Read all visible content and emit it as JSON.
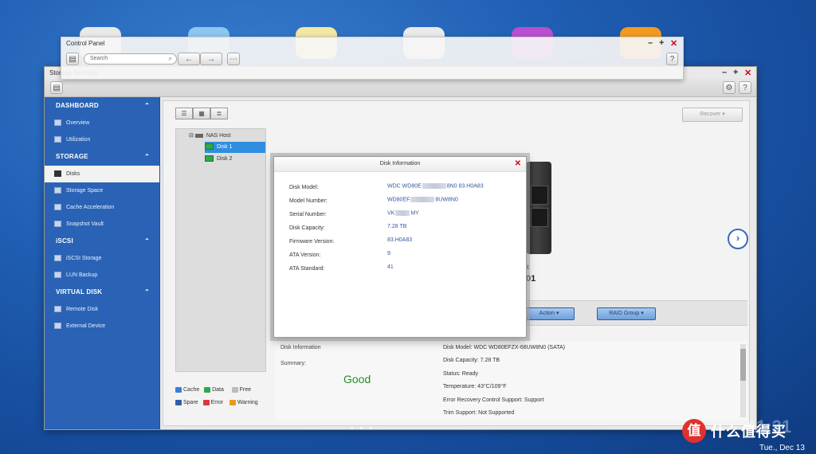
{
  "control_panel": {
    "title": "Control Panel",
    "search_placeholder": "Search"
  },
  "storage_manager": {
    "title": "Storage Manager",
    "sidebar": {
      "sections": [
        {
          "label": "DASHBOARD",
          "items": [
            "Overview",
            "Utilization"
          ]
        },
        {
          "label": "STORAGE",
          "items": [
            "Disks",
            "Storage Space",
            "Cache Acceleration",
            "Snapshot Vault"
          ]
        },
        {
          "label": "iSCSI",
          "items": [
            "iSCSI Storage",
            "LUN Backup"
          ]
        },
        {
          "label": "VIRTUAL DISK",
          "items": [
            "Remote Disk",
            "External Device"
          ]
        }
      ],
      "active_item": "Disks"
    },
    "recover_label": "Recover",
    "tree": {
      "host": "NAS Host",
      "disks": [
        "Disk 1",
        "Disk 2"
      ],
      "selected": "Disk 1"
    },
    "nas_label_partial_1": "t",
    "nas_label_partial_2": "01",
    "actions": {
      "action_label": "Action",
      "raid_label": "RAID Group"
    },
    "legend": [
      {
        "label": "Cache",
        "color": "#3a7fd6"
      },
      {
        "label": "Data",
        "color": "#2ea84a"
      },
      {
        "label": "Free",
        "color": "#bbbbbb"
      },
      {
        "label": "Spare",
        "color": "#2f5fa8"
      },
      {
        "label": "Error",
        "color": "#d63a3a"
      },
      {
        "label": "Warning",
        "color": "#e89a1c"
      }
    ],
    "info_pane": {
      "heading": "Disk Information",
      "summary_label": "Summary:",
      "summary_value": "Good",
      "details": [
        "Disk Model: WDC WD80EFZX-68UW8N0 (SATA)",
        "Disk Capacity: 7.28 TB",
        "Status: Ready",
        "Temperature: 43°C/109°F",
        "Error Recovery Control Support: Support",
        "Trim Support: Not Supported"
      ]
    }
  },
  "dialog": {
    "title": "Disk Information",
    "rows": [
      {
        "label": "Disk Model:",
        "value_a": "WDC WD80E",
        "value_b": "8N0 83.H0A83"
      },
      {
        "label": "Model Number:",
        "value_a": "WD80EF",
        "value_b": "8UW8N0"
      },
      {
        "label": "Serial Number:",
        "value_a": "VK",
        "value_b": "MY"
      },
      {
        "label": "Disk Capacity:",
        "value_a": "7.28 TB",
        "value_b": ""
      },
      {
        "label": "Firmware Version:",
        "value_a": "83.H0A83",
        "value_b": ""
      },
      {
        "label": "ATA Version:",
        "value_a": "9",
        "value_b": ""
      },
      {
        "label": "ATA Standard:",
        "value_a": "41",
        "value_b": ""
      }
    ]
  },
  "desktop": {
    "clock": "11:31",
    "date": "Tue., Dec 13",
    "brand_badge": "值",
    "brand_text": "什么值得买"
  }
}
